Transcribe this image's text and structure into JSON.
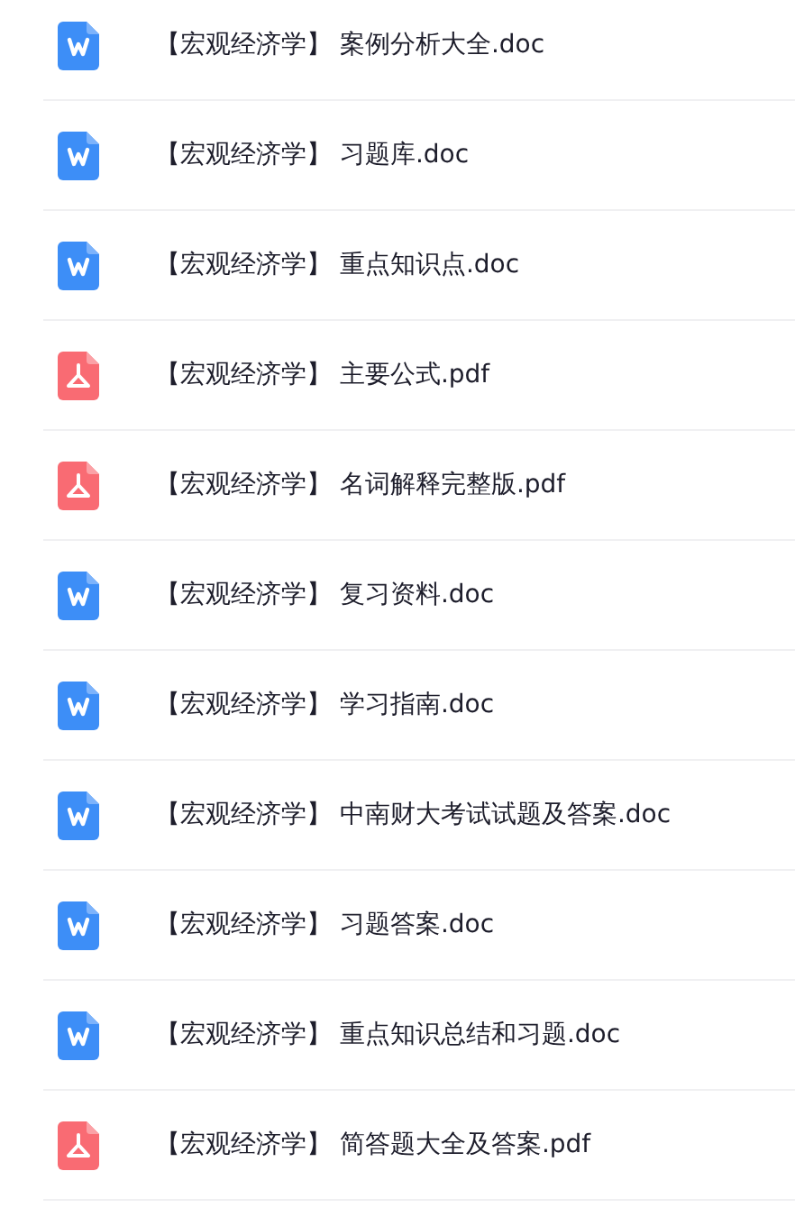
{
  "files": [
    {
      "kind": "doc",
      "name": "【宏观经济学】 案例分析大全.doc"
    },
    {
      "kind": "doc",
      "name": "【宏观经济学】 习题库.doc"
    },
    {
      "kind": "doc",
      "name": "【宏观经济学】 重点知识点.doc"
    },
    {
      "kind": "pdf",
      "name": "【宏观经济学】 主要公式.pdf"
    },
    {
      "kind": "pdf",
      "name": "【宏观经济学】 名词解释完整版.pdf"
    },
    {
      "kind": "doc",
      "name": "【宏观经济学】 复习资料.doc"
    },
    {
      "kind": "doc",
      "name": "【宏观经济学】 学习指南.doc"
    },
    {
      "kind": "doc",
      "name": "【宏观经济学】 中南财大考试试题及答案.doc"
    },
    {
      "kind": "doc",
      "name": "【宏观经济学】 习题答案.doc"
    },
    {
      "kind": "doc",
      "name": "【宏观经济学】 重点知识总结和习题.doc"
    },
    {
      "kind": "pdf",
      "name": "【宏观经济学】 简答题大全及答案.pdf"
    }
  ]
}
